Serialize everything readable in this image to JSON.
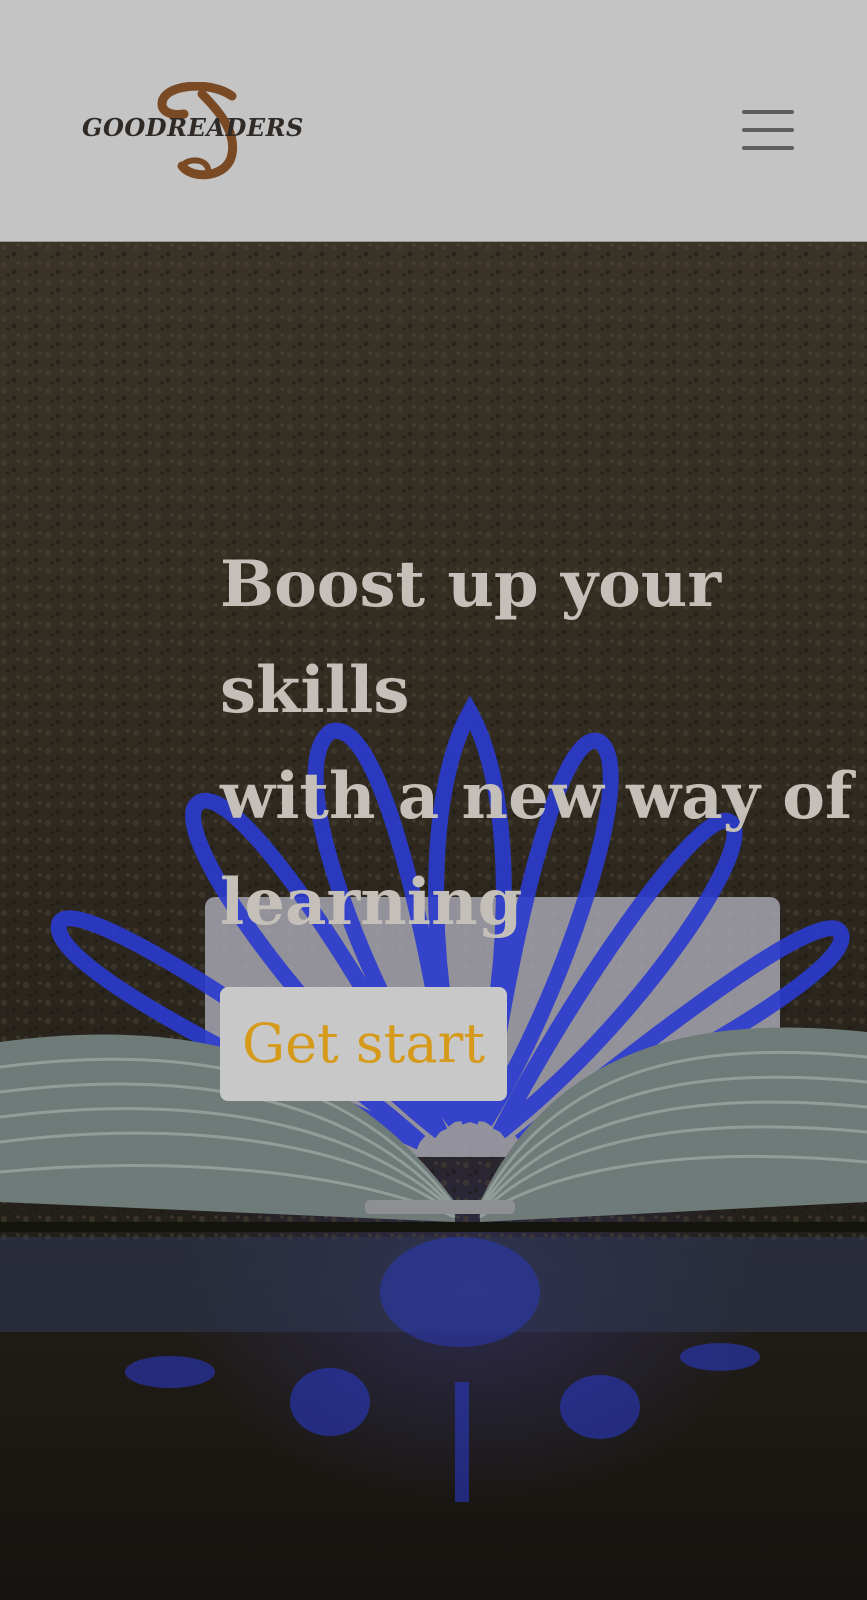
{
  "header": {
    "logo_text": "GOODREADERS",
    "logo_initial_icon": "g-monogram-icon",
    "menu_icon": "hamburger-menu-icon"
  },
  "hero": {
    "title_lines": [
      "Boost up your",
      "skills",
      "with a new way of",
      "learning"
    ],
    "cta_label": "Get start",
    "background_image": "open-book-pages-fanned-photo"
  },
  "colors": {
    "header_bg": "#c4c4c5",
    "logo_brown": "#7a4a25",
    "hero_text": "#c4c0b9",
    "cta_bg": "#c8c8c8",
    "cta_text": "#d69a1a",
    "accent_blue": "#2a3bd0"
  }
}
